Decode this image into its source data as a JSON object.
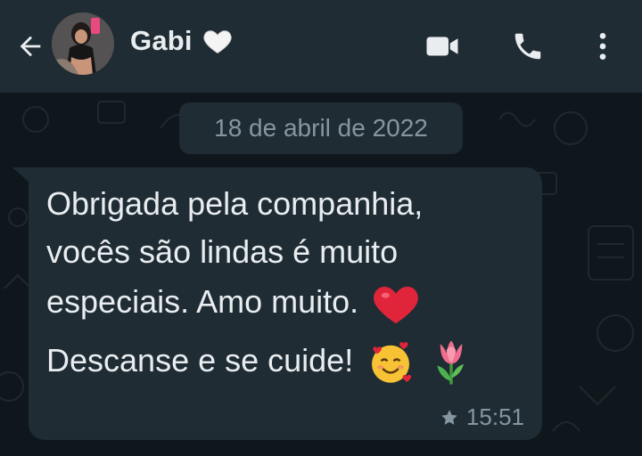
{
  "header": {
    "contact_name": "Gabi",
    "back_icon": "arrow-left-icon",
    "name_emoji": "white-heart-icon",
    "actions": [
      {
        "name": "video-call",
        "icon": "videocam-icon"
      },
      {
        "name": "voice-call",
        "icon": "phone-icon"
      },
      {
        "name": "more-options",
        "icon": "more-vert-icon"
      }
    ]
  },
  "chat": {
    "date_label": "18 de abril de 2022",
    "message": {
      "lines": [
        "Obrigada pela companhia,",
        "vocês são lindas é muito",
        "especiais. Amo muito.",
        "Descanse e se cuide!"
      ],
      "emojis": [
        "red-heart-icon",
        "smiling-face-with-hearts-icon",
        "tulip-icon"
      ],
      "time": "15:51",
      "starred": true
    }
  },
  "colors": {
    "header_bg": "#1f2c34",
    "chat_bg": "#0f171d",
    "bubble_bg": "#1f2c34",
    "text_primary": "#e9edef",
    "text_secondary": "#8696a0"
  }
}
